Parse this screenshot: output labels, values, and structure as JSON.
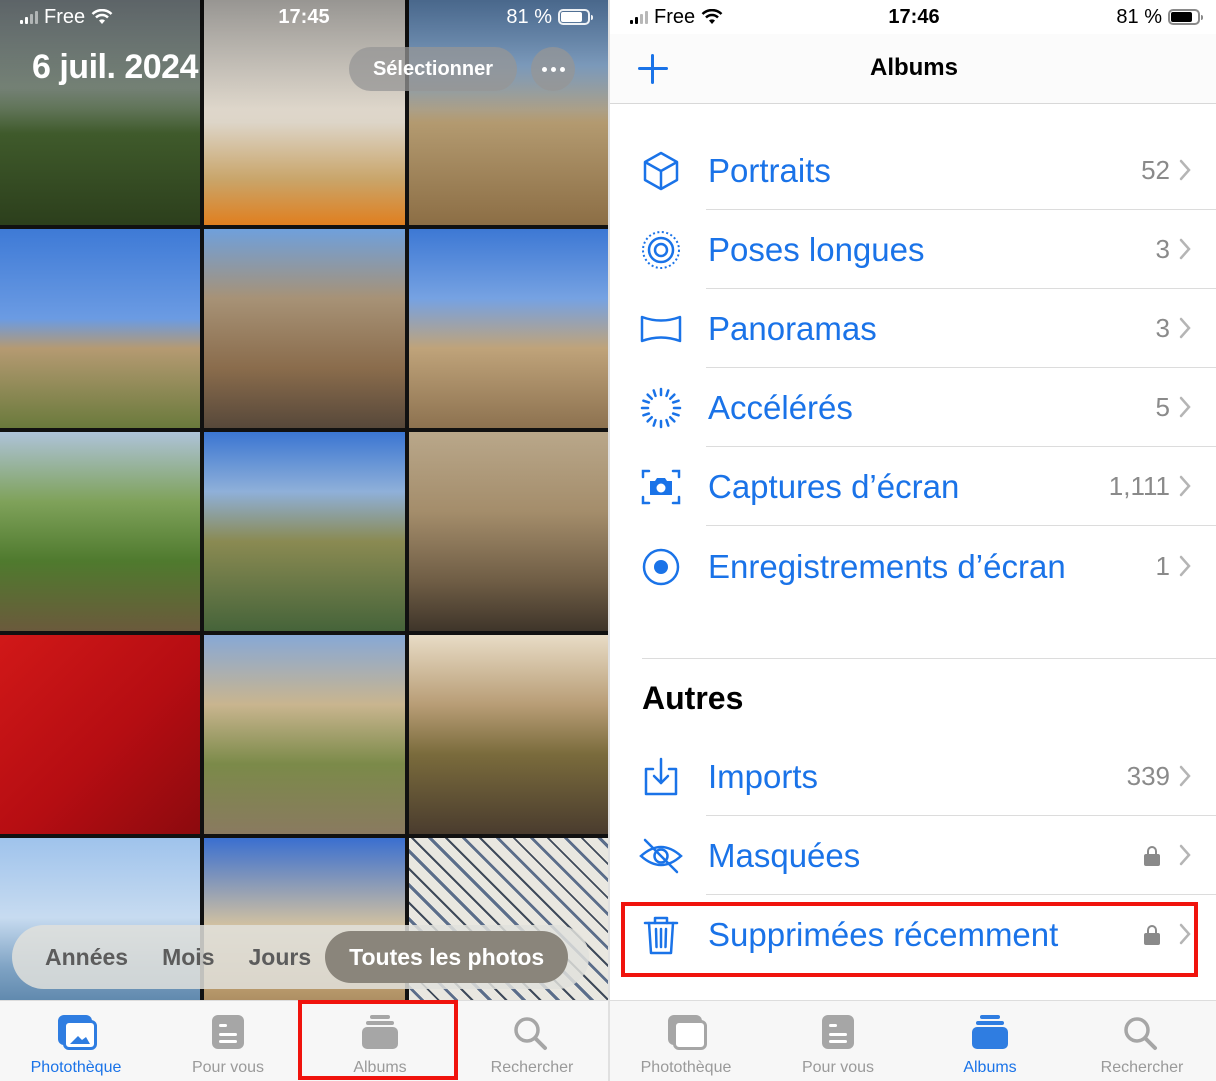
{
  "left_panel": {
    "status_bar": {
      "carrier": "Free",
      "time": "17:45",
      "battery": "81 %"
    },
    "date_title": "6 juil. 2024",
    "select_button": "Sélectionner",
    "more_button_icon": "ellipsis-icon",
    "view_switcher": {
      "options": [
        "Années",
        "Mois",
        "Jours",
        "Toutes les photos"
      ],
      "selected": "Toutes les photos"
    },
    "tab_bar": {
      "tabs": [
        {
          "label": "Photothèque",
          "icon": "photo-library-icon",
          "active": true
        },
        {
          "label": "Pour vous",
          "icon": "for-you-icon",
          "active": false
        },
        {
          "label": "Albums",
          "icon": "albums-icon",
          "active": false
        },
        {
          "label": "Rechercher",
          "icon": "search-icon",
          "active": false
        }
      ]
    },
    "highlighted_tab": "Albums"
  },
  "right_panel": {
    "status_bar": {
      "carrier": "Free",
      "time": "17:46",
      "battery": "81 %"
    },
    "nav": {
      "title": "Albums",
      "add_icon": "plus-icon"
    },
    "media_types": [
      {
        "label": "Portraits",
        "count": "52",
        "icon": "cube-icon"
      },
      {
        "label": "Poses longues",
        "count": "3",
        "icon": "long-exposure-icon"
      },
      {
        "label": "Panoramas",
        "count": "3",
        "icon": "panorama-icon"
      },
      {
        "label": "Accélérés",
        "count": "5",
        "icon": "timelapse-icon"
      },
      {
        "label": "Captures d’écran",
        "count": "1,111",
        "icon": "screenshot-icon"
      },
      {
        "label": "Enregistrements d’écran",
        "count": "1",
        "icon": "screen-recording-icon"
      }
    ],
    "others_section": {
      "title": "Autres",
      "items": [
        {
          "label": "Imports",
          "count": "339",
          "icon": "import-icon",
          "locked": false
        },
        {
          "label": "Masquées",
          "count": "",
          "icon": "hidden-eye-icon",
          "locked": true
        },
        {
          "label": "Supprimées récemment",
          "count": "",
          "icon": "trash-icon",
          "locked": true
        }
      ]
    },
    "highlighted_item": "Supprimées récemment",
    "tab_bar": {
      "tabs": [
        {
          "label": "Photothèque",
          "icon": "photo-library-icon",
          "active": false
        },
        {
          "label": "Pour vous",
          "icon": "for-you-icon",
          "active": false
        },
        {
          "label": "Albums",
          "icon": "albums-icon",
          "active": true
        },
        {
          "label": "Rechercher",
          "icon": "search-icon",
          "active": false
        }
      ]
    }
  },
  "colors": {
    "accent": "#1a73e8",
    "highlight_box": "#f0130d",
    "inactive": "#9a9a9a"
  }
}
